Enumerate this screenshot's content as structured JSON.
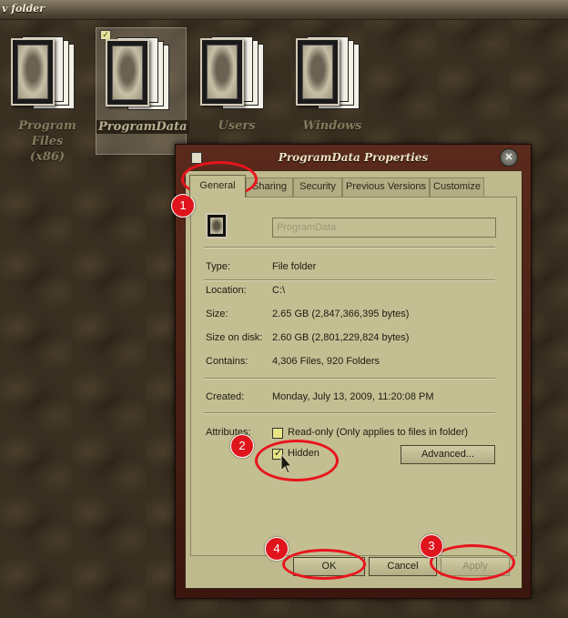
{
  "window": {
    "title": "v folder"
  },
  "desktop": {
    "folders": [
      {
        "label_line1": "Program Files",
        "label_line2": "(x86)",
        "selected": false
      },
      {
        "label_line1": "ProgramData",
        "label_line2": "",
        "selected": true
      },
      {
        "label_line1": "Users",
        "label_line2": "",
        "selected": false
      },
      {
        "label_line1": "Windows",
        "label_line2": "",
        "selected": false
      }
    ]
  },
  "dialog": {
    "title": "ProgramData Properties",
    "close_glyph": "✕",
    "tabs": [
      {
        "label": "General",
        "active": true
      },
      {
        "label": "Sharing",
        "active": false
      },
      {
        "label": "Security",
        "active": false
      },
      {
        "label": "Previous Versions",
        "active": false
      },
      {
        "label": "Customize",
        "active": false
      }
    ],
    "name_value": "ProgramData",
    "properties": {
      "type_label": "Type:",
      "type_value": "File folder",
      "location_label": "Location:",
      "location_value": "C:\\",
      "size_label": "Size:",
      "size_value": "2.65 GB (2,847,366,395 bytes)",
      "size_on_disk_label": "Size on disk:",
      "size_on_disk_value": "2.60 GB (2,801,229,824 bytes)",
      "contains_label": "Contains:",
      "contains_value": "4,306 Files, 920 Folders",
      "created_label": "Created:",
      "created_value": "Monday, July 13, 2009, 11:20:08 PM"
    },
    "attributes": {
      "label": "Attributes:",
      "readonly_label": "Read-only (Only applies to files in folder)",
      "readonly_checked": false,
      "hidden_label": "Hidden",
      "hidden_checked": true,
      "advanced_label": "Advanced..."
    },
    "buttons": {
      "ok_label": "OK",
      "cancel_label": "Cancel",
      "apply_label": "Apply",
      "apply_enabled": false
    }
  },
  "annotations": {
    "markers": [
      "1",
      "2",
      "3",
      "4"
    ],
    "color": "#e8141c"
  }
}
